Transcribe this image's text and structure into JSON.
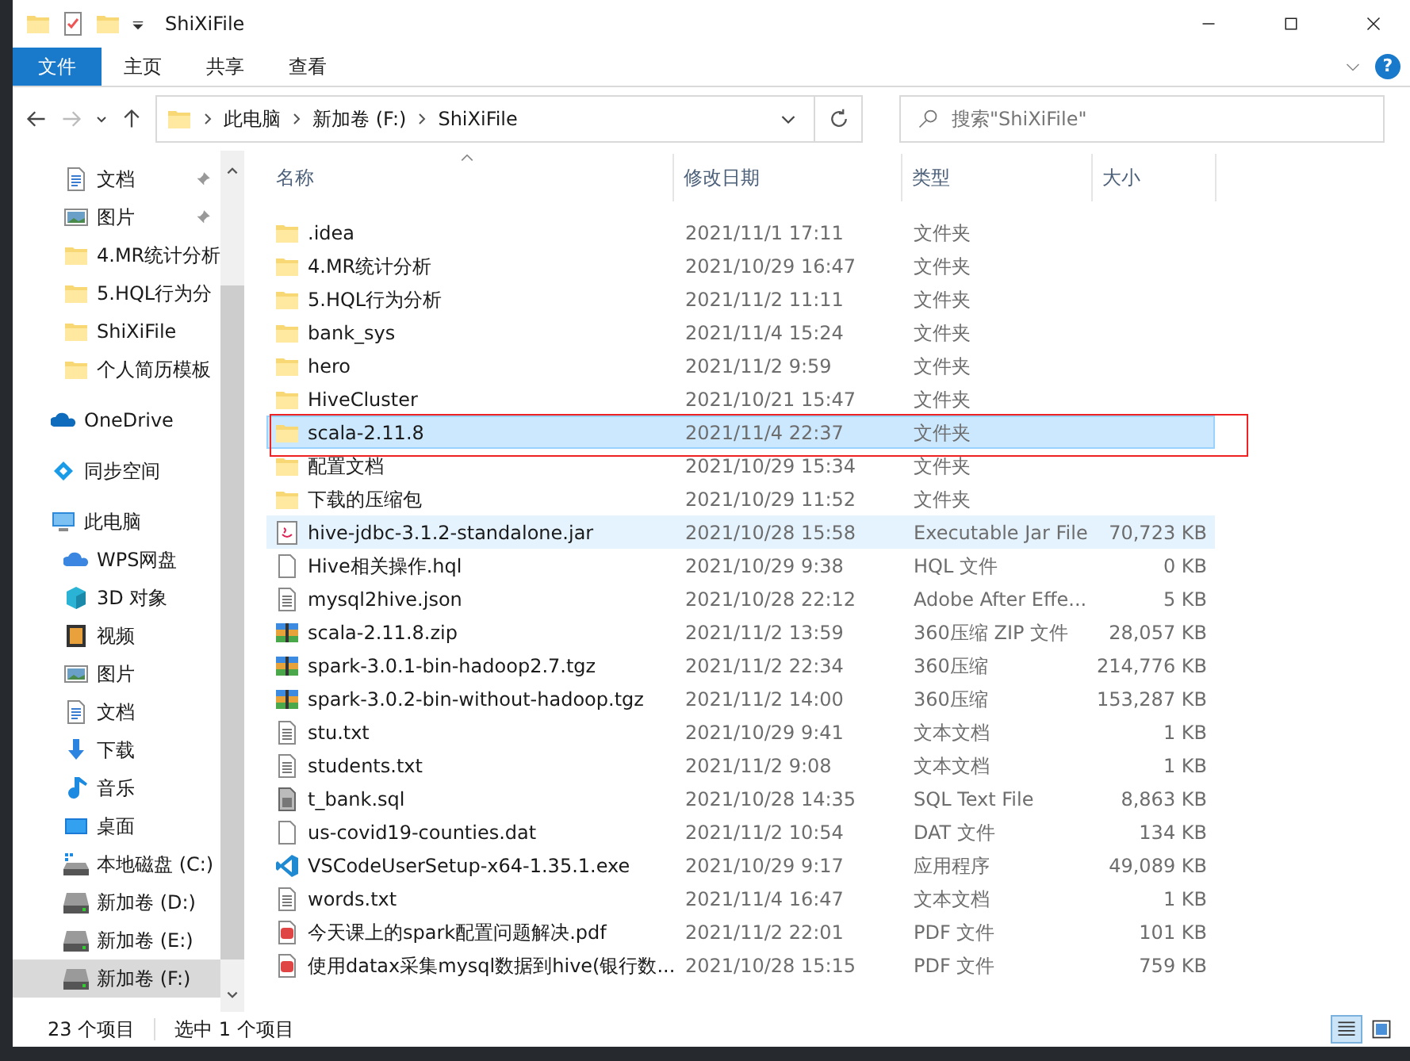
{
  "window": {
    "title": "ShiXiFile"
  },
  "ribbon": {
    "tabs": [
      {
        "label": "文件",
        "kind": "file"
      },
      {
        "label": "主页",
        "kind": "tab"
      },
      {
        "label": "共享",
        "kind": "tab"
      },
      {
        "label": "查看",
        "kind": "tab"
      }
    ],
    "help": "?"
  },
  "address": {
    "crumbs": [
      "此电脑",
      "新加卷 (F:)",
      "ShiXiFile"
    ]
  },
  "search": {
    "placeholder": "搜索\"ShiXiFile\""
  },
  "sidebar": {
    "quick_access": [
      {
        "label": "文档",
        "kind": "doc",
        "pinned": true
      },
      {
        "label": "图片",
        "kind": "pictures",
        "pinned": true
      },
      {
        "label": "4.MR统计分析",
        "kind": "folder",
        "pinned": false
      },
      {
        "label": "5.HQL行为分",
        "kind": "folder",
        "pinned": false
      },
      {
        "label": "ShiXiFile",
        "kind": "folder",
        "pinned": false
      },
      {
        "label": "个人简历模板",
        "kind": "folder",
        "pinned": false
      }
    ],
    "items": [
      {
        "label": "OneDrive",
        "kind": "onedrive",
        "selected": false
      },
      {
        "label": "同步空间",
        "kind": "sync",
        "selected": false
      },
      {
        "label": "此电脑",
        "kind": "pc",
        "selected": false,
        "children": [
          {
            "label": "WPS网盘",
            "kind": "cloud",
            "selected": false
          },
          {
            "label": "3D 对象",
            "kind": "cube",
            "selected": false
          },
          {
            "label": "视频",
            "kind": "video",
            "selected": false
          },
          {
            "label": "图片",
            "kind": "pictures",
            "selected": false
          },
          {
            "label": "文档",
            "kind": "doc",
            "selected": false
          },
          {
            "label": "下载",
            "kind": "download",
            "selected": false
          },
          {
            "label": "音乐",
            "kind": "music",
            "selected": false
          },
          {
            "label": "桌面",
            "kind": "desktop",
            "selected": false
          },
          {
            "label": "本地磁盘 (C:)",
            "kind": "sysdrive",
            "selected": false
          },
          {
            "label": "新加卷 (D:)",
            "kind": "drive",
            "selected": false
          },
          {
            "label": "新加卷 (E:)",
            "kind": "drive",
            "selected": false
          },
          {
            "label": "新加卷 (F:)",
            "kind": "drive",
            "selected": true
          }
        ]
      }
    ]
  },
  "table": {
    "columns": [
      "名称",
      "修改日期",
      "类型",
      "大小"
    ],
    "rows": [
      {
        "name": ".idea",
        "date": "2021/11/1 17:11",
        "type": "文件夹",
        "kind": "folder",
        "selected": false,
        "hovered": false,
        "outlined": false
      },
      {
        "name": "4.MR统计分析",
        "date": "2021/10/29 16:47",
        "type": "文件夹",
        "kind": "folder",
        "selected": false,
        "hovered": false,
        "outlined": false
      },
      {
        "name": "5.HQL行为分析",
        "date": "2021/11/2 11:11",
        "type": "文件夹",
        "kind": "folder",
        "selected": false,
        "hovered": false,
        "outlined": false
      },
      {
        "name": "bank_sys",
        "date": "2021/11/4 15:24",
        "type": "文件夹",
        "kind": "folder",
        "selected": false,
        "hovered": false,
        "outlined": false
      },
      {
        "name": "hero",
        "date": "2021/11/2 9:59",
        "type": "文件夹",
        "kind": "folder",
        "selected": false,
        "hovered": false,
        "outlined": false
      },
      {
        "name": "HiveCluster",
        "date": "2021/10/21 15:47",
        "type": "文件夹",
        "kind": "folder",
        "selected": false,
        "hovered": false,
        "outlined": false
      },
      {
        "name": "scala-2.11.8",
        "date": "2021/11/4 22:37",
        "type": "文件夹",
        "kind": "folder",
        "selected": true,
        "hovered": false,
        "outlined": true
      },
      {
        "name": "配置文档",
        "date": "2021/10/29 15:34",
        "type": "文件夹",
        "kind": "folder",
        "selected": false,
        "hovered": false,
        "outlined": false
      },
      {
        "name": "下载的压缩包",
        "date": "2021/10/29 11:52",
        "type": "文件夹",
        "kind": "folder",
        "selected": false,
        "hovered": false,
        "outlined": false
      },
      {
        "name": "hive-jdbc-3.1.2-standalone.jar",
        "date": "2021/10/28 15:58",
        "type": "Executable Jar File",
        "size": "70,723 KB",
        "kind": "jar",
        "selected": false,
        "hovered": true,
        "outlined": false
      },
      {
        "name": "Hive相关操作.hql",
        "date": "2021/10/29 9:38",
        "type": "HQL 文件",
        "size": "0 KB",
        "kind": "blank",
        "selected": false,
        "hovered": false,
        "outlined": false
      },
      {
        "name": "mysql2hive.json",
        "date": "2021/10/28 22:12",
        "type": "Adobe After Effe...",
        "size": "5 KB",
        "kind": "text",
        "selected": false,
        "hovered": false,
        "outlined": false
      },
      {
        "name": "scala-2.11.8.zip",
        "date": "2021/11/2 13:59",
        "type": "360压缩 ZIP 文件",
        "size": "28,057 KB",
        "kind": "zip",
        "selected": false,
        "hovered": false,
        "outlined": false
      },
      {
        "name": "spark-3.0.1-bin-hadoop2.7.tgz",
        "date": "2021/11/2 22:34",
        "type": "360压缩",
        "size": "214,776 KB",
        "kind": "zip",
        "selected": false,
        "hovered": false,
        "outlined": false
      },
      {
        "name": "spark-3.0.2-bin-without-hadoop.tgz",
        "date": "2021/11/2 14:00",
        "type": "360压缩",
        "size": "153,287 KB",
        "kind": "zip",
        "selected": false,
        "hovered": false,
        "outlined": false
      },
      {
        "name": "stu.txt",
        "date": "2021/10/29 9:41",
        "type": "文本文档",
        "size": "1 KB",
        "kind": "text",
        "selected": false,
        "hovered": false,
        "outlined": false
      },
      {
        "name": "students.txt",
        "date": "2021/11/2 9:08",
        "type": "文本文档",
        "size": "1 KB",
        "kind": "text",
        "selected": false,
        "hovered": false,
        "outlined": false
      },
      {
        "name": "t_bank.sql",
        "date": "2021/10/28 14:35",
        "type": "SQL Text File",
        "size": "8,863 KB",
        "kind": "sql",
        "selected": false,
        "hovered": false,
        "outlined": false
      },
      {
        "name": "us-covid19-counties.dat",
        "date": "2021/11/2 10:54",
        "type": "DAT 文件",
        "size": "134 KB",
        "kind": "blank",
        "selected": false,
        "hovered": false,
        "outlined": false
      },
      {
        "name": "VSCodeUserSetup-x64-1.35.1.exe",
        "date": "2021/10/29 9:17",
        "type": "应用程序",
        "size": "49,089 KB",
        "kind": "vscode",
        "selected": false,
        "hovered": false,
        "outlined": false
      },
      {
        "name": "words.txt",
        "date": "2021/11/4 16:47",
        "type": "文本文档",
        "size": "1 KB",
        "kind": "text",
        "selected": false,
        "hovered": false,
        "outlined": false
      },
      {
        "name": "今天课上的spark配置问题解决.pdf",
        "date": "2021/11/2 22:01",
        "type": "PDF 文件",
        "size": "101 KB",
        "kind": "pdf",
        "selected": false,
        "hovered": false,
        "outlined": false
      },
      {
        "name": "使用datax采集mysql数据到hive(银行数...",
        "date": "2021/10/28 15:15",
        "type": "PDF 文件",
        "size": "759 KB",
        "kind": "pdf",
        "selected": false,
        "hovered": false,
        "outlined": false
      }
    ]
  },
  "status_bar": {
    "count": "23 个项目",
    "selection": "选中 1 个项目",
    "views": [
      {
        "kind": "details",
        "selected": true
      },
      {
        "kind": "tiles",
        "selected": false
      }
    ]
  }
}
